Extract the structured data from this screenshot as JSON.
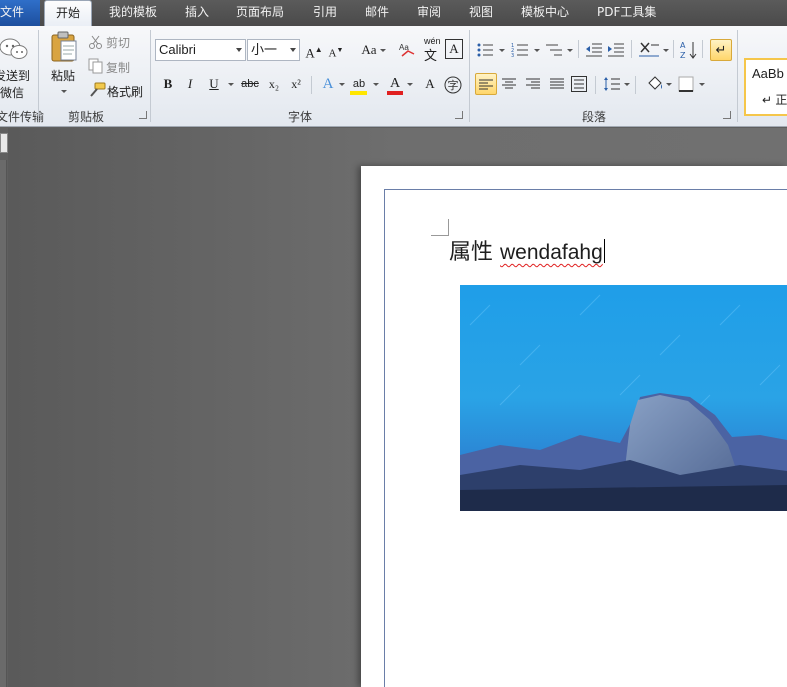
{
  "tabs": {
    "file": "文件",
    "items": [
      "开始",
      "我的模板",
      "插入",
      "页面布局",
      "引用",
      "邮件",
      "审阅",
      "视图",
      "模板中心",
      "PDF工具集"
    ]
  },
  "ribbon": {
    "send_group": {
      "label_line1": "发送到",
      "label_line2": "微信",
      "group_label": "文件传输"
    },
    "clipboard": {
      "paste": "粘贴",
      "cut": "剪切",
      "copy": "复制",
      "format_painter": "格式刷",
      "group_label": "剪贴板"
    },
    "font": {
      "font_name": "Calibri",
      "font_size": "小一",
      "group_label": "字体",
      "bold": "B",
      "italic": "I",
      "underline": "U",
      "strike": "abc",
      "subscript": "x₂",
      "superscript": "x²",
      "case": "Aa",
      "grow": "A",
      "shrink": "A",
      "char_shade": "A",
      "text_effect": "A",
      "font_color": "A",
      "highlight": "ab",
      "phonetic": "wén"
    },
    "paragraph": {
      "group_label": "段落"
    },
    "styles": {
      "preview": "AaBb",
      "name": "↵ 正"
    }
  },
  "document": {
    "text_cjk": "属性",
    "text_latin": "wendafahg"
  },
  "colors": {
    "accent_blue": "#2f6fc9",
    "highlight_yellow": "#ffe600",
    "font_red": "#e02020",
    "selected_button": "#ffd66b"
  }
}
